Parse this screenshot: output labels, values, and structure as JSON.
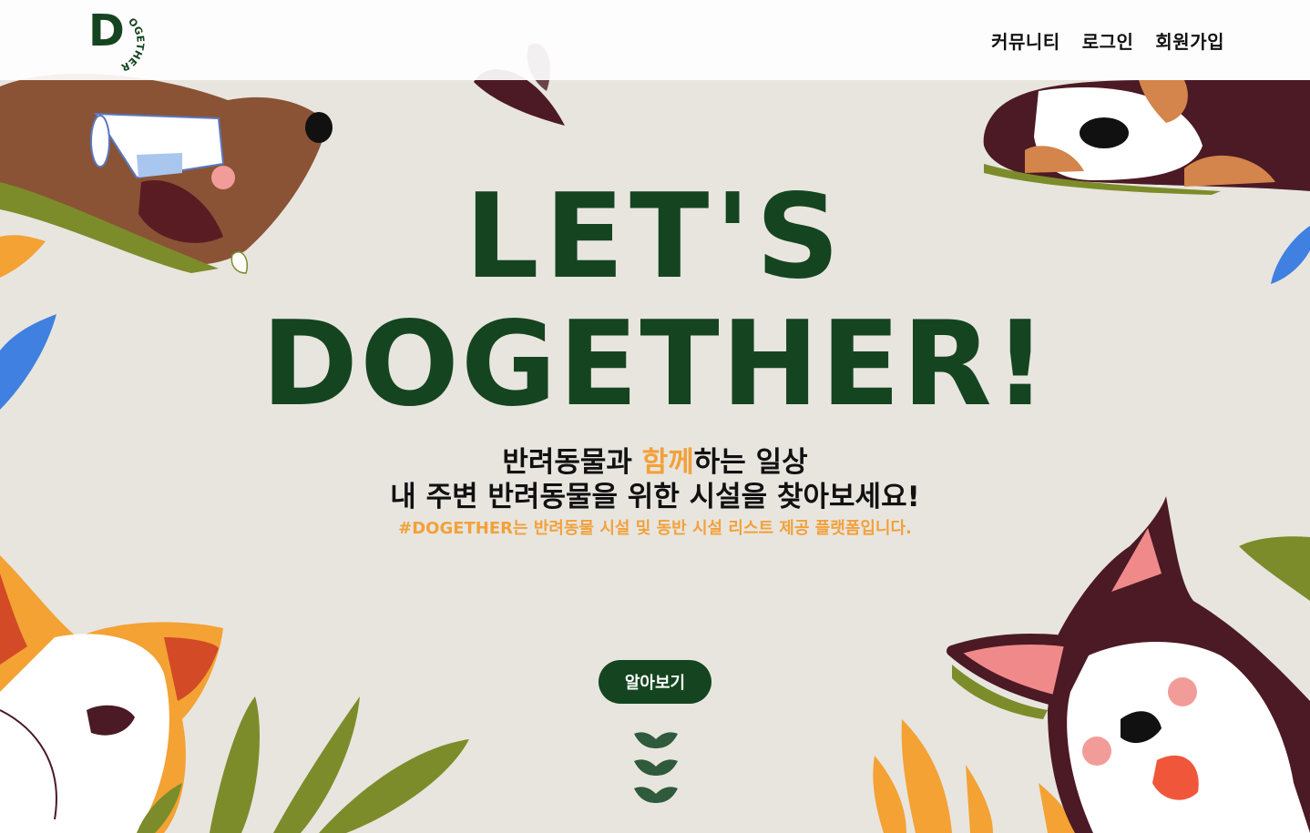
{
  "header": {
    "logo_letter": "D",
    "logo_text": "OGETHER",
    "nav": [
      "커뮤니티",
      "로그인",
      "회원가입"
    ]
  },
  "hero": {
    "title_line1": "LET'S",
    "title_line2": "DOGETHER!",
    "subtitle_line1_pre": "반려동물과 ",
    "subtitle_line1_accent": "함께",
    "subtitle_line1_post": "하는 일상",
    "subtitle_line2": "내 주변 반려동물을 위한 시설을 찾아보세요!",
    "description": "#DOGETHER는 반려동물 시설 및 동반 시설 리스트 제공 플랫폼입니다.",
    "cta_label": "알아보기"
  },
  "colors": {
    "brand_green": "#154520",
    "accent_orange": "#f2a13a",
    "background": "#e8e5df"
  },
  "icons": [
    "logo-icon",
    "scroll-down-chevrons-icon"
  ]
}
